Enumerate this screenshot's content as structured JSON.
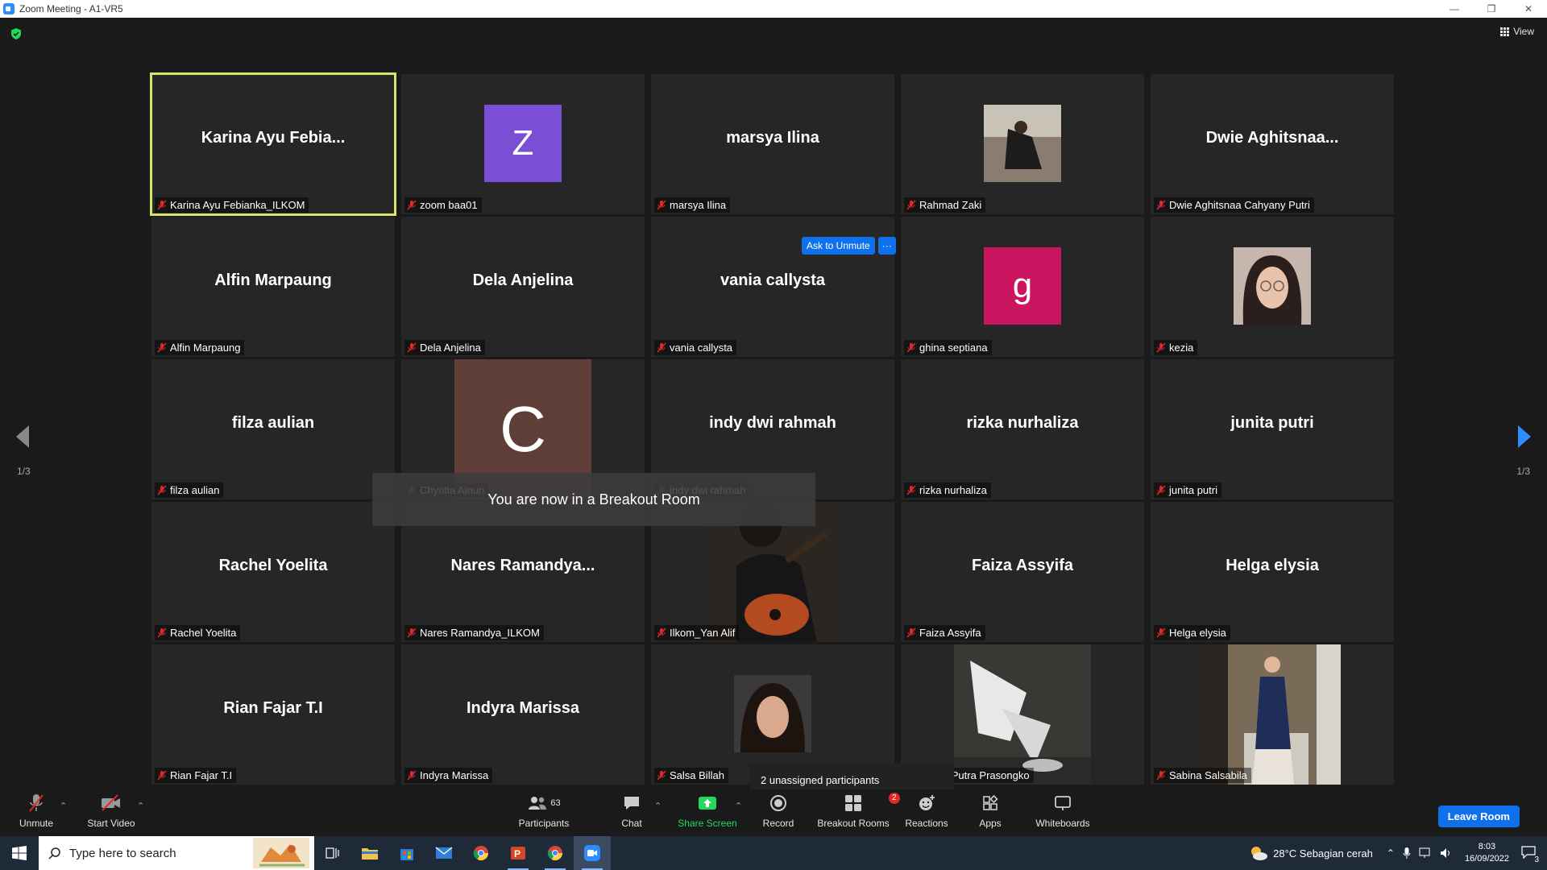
{
  "window": {
    "title": "Zoom Meeting - A1-VR5"
  },
  "header": {
    "view_label": "View"
  },
  "tiles": [
    {
      "big": "Karina Ayu Febia...",
      "label": "Karina Ayu Febianka_ILKOM"
    },
    {
      "big": "Z",
      "label": "zoom baa01"
    },
    {
      "big": "marsya Ilina",
      "label": "marsya Ilina"
    },
    {
      "big": "",
      "label": "Rahmad Zaki"
    },
    {
      "big": "Dwie Aghitsnaa...",
      "label": "Dwie Aghitsnaa Cahyany Putri"
    },
    {
      "big": "Alfin Marpaung",
      "label": "Alfin Marpaung"
    },
    {
      "big": "Dela Anjelina",
      "label": "Dela Anjelina"
    },
    {
      "big": "vania callysta",
      "label": "vania callysta"
    },
    {
      "big": "g",
      "label": "ghina septiana"
    },
    {
      "big": "",
      "label": "kezia"
    },
    {
      "big": "filza aulian",
      "label": "filza aulian"
    },
    {
      "big": "C",
      "label": "Chyntia Ainun"
    },
    {
      "big": "indy dwi rahmah",
      "label": "indy dwi rahmah"
    },
    {
      "big": "rizka nurhaliza",
      "label": "rizka nurhaliza"
    },
    {
      "big": "junita putri",
      "label": "junita putri"
    },
    {
      "big": "Rachel Yoelita",
      "label": "Rachel Yoelita"
    },
    {
      "big": "Nares Ramandya...",
      "label": "Nares Ramandya_ILKOM"
    },
    {
      "big": "",
      "label": "Ilkom_Yan Alif"
    },
    {
      "big": "Faiza Assyifa",
      "label": "Faiza Assyifa"
    },
    {
      "big": "Helga elysia",
      "label": "Helga elysia"
    },
    {
      "big": "Rian Fajar T.I",
      "label": "Rian Fajar T.I"
    },
    {
      "big": "Indyra Marissa",
      "label": "Indyra Marissa"
    },
    {
      "big": "",
      "label": "Salsa Billah"
    },
    {
      "big": "",
      "label": "Aditya Putra Prasongko"
    },
    {
      "big": "",
      "label": "Sabina Salsabila"
    }
  ],
  "colors": {
    "avatar_z": "#7a4fd6",
    "avatar_g": "#cc1561",
    "avatar_c": "#5e3e36",
    "active_border": "#dbe26a",
    "accent": "#0e71eb"
  },
  "pager": {
    "left": "1/3",
    "right": "1/3"
  },
  "ask_unmute": {
    "label": "Ask to Unmute",
    "more": "···"
  },
  "toast": "You are now in a Breakout Room",
  "unassigned": "2 unassigned participants",
  "toolbar": {
    "unmute": "Unmute",
    "start_video": "Start Video",
    "participants": "Participants",
    "participants_count": "63",
    "chat": "Chat",
    "share_screen": "Share Screen",
    "record": "Record",
    "breakout_rooms": "Breakout Rooms",
    "breakout_badge": "2",
    "reactions": "Reactions",
    "apps": "Apps",
    "whiteboards": "Whiteboards",
    "leave": "Leave Room"
  },
  "taskbar": {
    "search_placeholder": "Type here to search",
    "weather": "28°C  Sebagian cerah",
    "time": "8:03",
    "date": "16/09/2022",
    "notif_count": "3"
  },
  "icons": [
    "shield-icon",
    "grid-icon",
    "mic-off-icon",
    "video-off-icon",
    "participants-icon",
    "chat-icon",
    "share-screen-icon",
    "record-icon",
    "breakout-rooms-icon",
    "reactions-icon",
    "apps-icon",
    "whiteboards-icon",
    "windows-start-icon",
    "search-icon"
  ]
}
